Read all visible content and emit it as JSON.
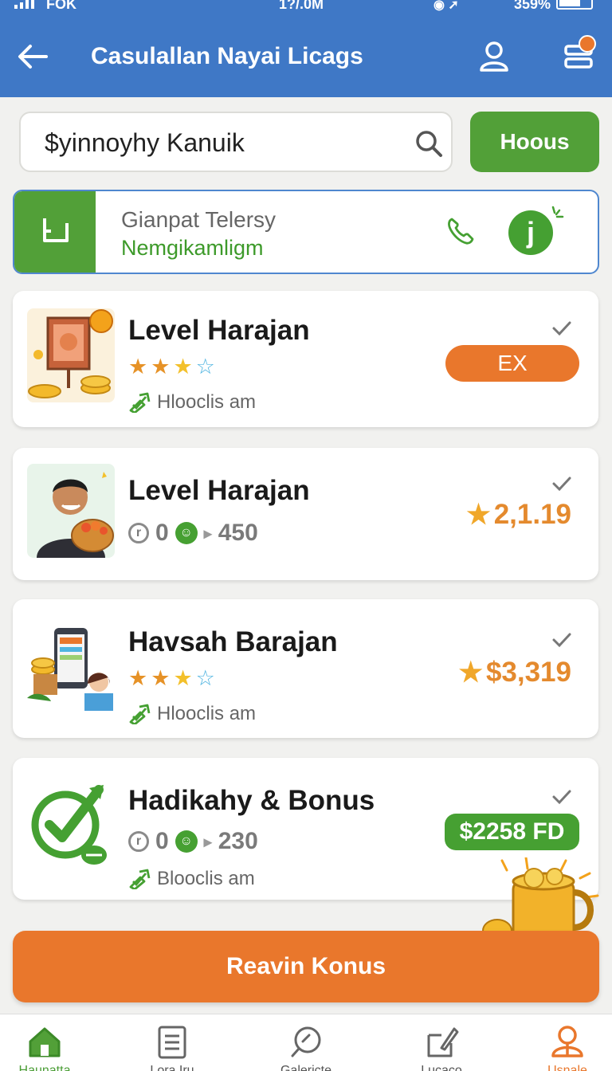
{
  "status_bar": {
    "carrier": "FOK",
    "time": "1?/.0M",
    "battery": "359%"
  },
  "header": {
    "title": "Casulallan Nayai Licags"
  },
  "search": {
    "value": "$yinnoyhy Kanuik",
    "button_label": "Hoous"
  },
  "contact": {
    "line1": "Gianpat Telersy",
    "line2": "Nemgikamligm",
    "badge": "j"
  },
  "cards": [
    {
      "name": "Level Harajan",
      "rating": 3,
      "meta": "Hlooclis am",
      "action": "EX"
    },
    {
      "name": "Level Harajan",
      "count_a": "0",
      "count_b": "450",
      "amount": "2,1.19"
    },
    {
      "name": "Havsah Barajan",
      "rating": 3,
      "meta": "Hlooclis am",
      "amount": "$3,319"
    },
    {
      "name": "Hadikahy & Bonus",
      "count_a": "0",
      "count_b": "230",
      "meta": "Blooclis am",
      "amount": "$2258 FD"
    }
  ],
  "cta": {
    "label": "Reavin Konus"
  },
  "nav": {
    "items": [
      {
        "label": "Haunatta"
      },
      {
        "label": "Lora Iru"
      },
      {
        "label": "Galericte"
      },
      {
        "label": "Lucaco"
      },
      {
        "label": "Usnale"
      }
    ]
  },
  "colors": {
    "header_blue": "#3f78c6",
    "brand_green": "#52a038",
    "accent_orange": "#e9772c"
  }
}
